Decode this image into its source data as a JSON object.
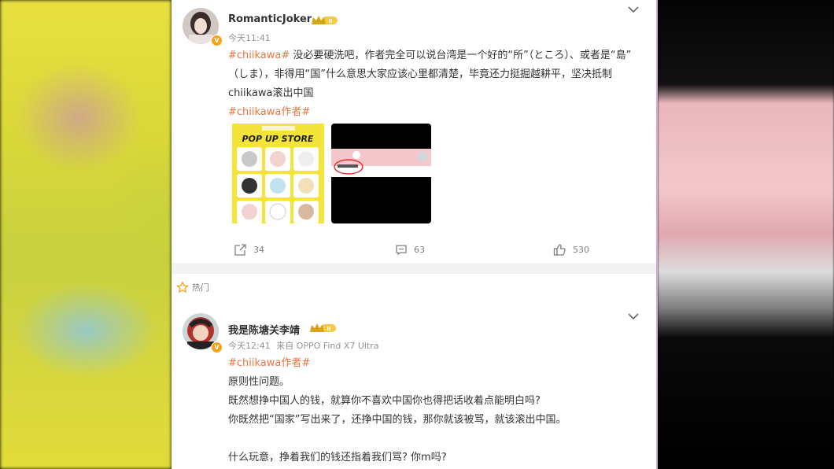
{
  "post1": {
    "username": "RomanticJoker",
    "level_badge": "II",
    "time": "今天11:41",
    "line1_tag": "#chiikawa#",
    "line1_text": " 没必要硬洗吧，作者完全可以说台湾是一个好的“所”（ところ）、或者是“島”",
    "line2_text": "（しま），非得用“国”什么意思大家应该心里都清楚，毕竟还力挺掘越耕平，坚决抵制",
    "line3_text": "chiikawa滚出中国",
    "tag2": "#chiikawa作者#",
    "image1": {
      "title": "POP UP STORE"
    },
    "reposts": "34",
    "comments": "63",
    "likes": "530"
  },
  "hot_label": "热门",
  "post2": {
    "username": "我是陈塘关李靖",
    "level_badge": "II",
    "time": "今天12:41",
    "source": "来自 OPPO Find X7 Ultra",
    "tag": "#chiikawa作者#",
    "lines": [
      "原则性问题。",
      "既然想挣中国人的钱，就算你不喜欢中国你也得把话收着点能明白吗?",
      "你既然把“国家”写出来了，还挣中国的钱，那你就该被骂，就该滚出中国。",
      "什么玩意，挣着我们的钱还指着我们骂? 你m吗?"
    ]
  },
  "colors": {
    "accent": "#eb7340",
    "badge": "#f7a21b",
    "text": "#333333",
    "meta": "#939393"
  }
}
